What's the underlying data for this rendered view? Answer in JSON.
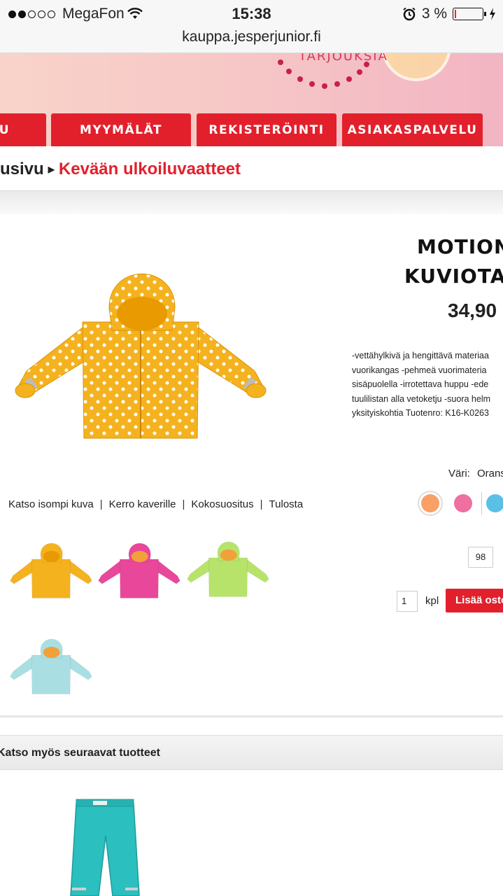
{
  "status_bar": {
    "carrier": "MegaFon",
    "time": "15:38",
    "battery": "3 %",
    "signal_bars_filled": 2,
    "signal_bars_total": 5
  },
  "url": "kauppa.jesperjunior.fi",
  "banner": {
    "text": "TARJOUKSIA"
  },
  "nav": {
    "items": [
      {
        "label": "U"
      },
      {
        "label": "MYYMÄLÄT"
      },
      {
        "label": "REKISTERÖINTI"
      },
      {
        "label": "ASIAKASPALVELU"
      }
    ]
  },
  "breadcrumb": {
    "home": "usivu",
    "current": "Kevään ulkoiluvaatteet"
  },
  "product": {
    "title_line1": "MOTION",
    "title_line2": "KUVIOTA",
    "price": "34,90",
    "description_lines": [
      "-vettähylkivä ja hengittävä materiaa",
      "vuorikangas -pehmeä vuorimateria",
      "sisäpuolella -irrotettava huppu -ede",
      "tuulilistan alla vetoketju -suora helm",
      "yksityiskohtia Tuotenro: K16-K0263"
    ],
    "color_label": "Väri:",
    "color_value": "Orans",
    "swatches": [
      "#f9a066",
      "#ee6fa0",
      "#5bc0e8"
    ],
    "size": "98",
    "quantity": "1",
    "qty_unit": "kpl",
    "add_button": "Lisää osto",
    "jacket_colors": [
      "#f5b21f",
      "#e9479a",
      "#b7e36a",
      "#a9dfe2"
    ]
  },
  "links": [
    {
      "label": "Katso isompi kuva"
    },
    {
      "label": "Kerro kaverille"
    },
    {
      "label": "Kokosuositus"
    },
    {
      "label": "Tulosta"
    }
  ],
  "see_also": {
    "title": "Katso myös seuraavat tuotteet"
  },
  "colors": {
    "accent": "#e2202c",
    "pants": "#2bbfbf"
  }
}
